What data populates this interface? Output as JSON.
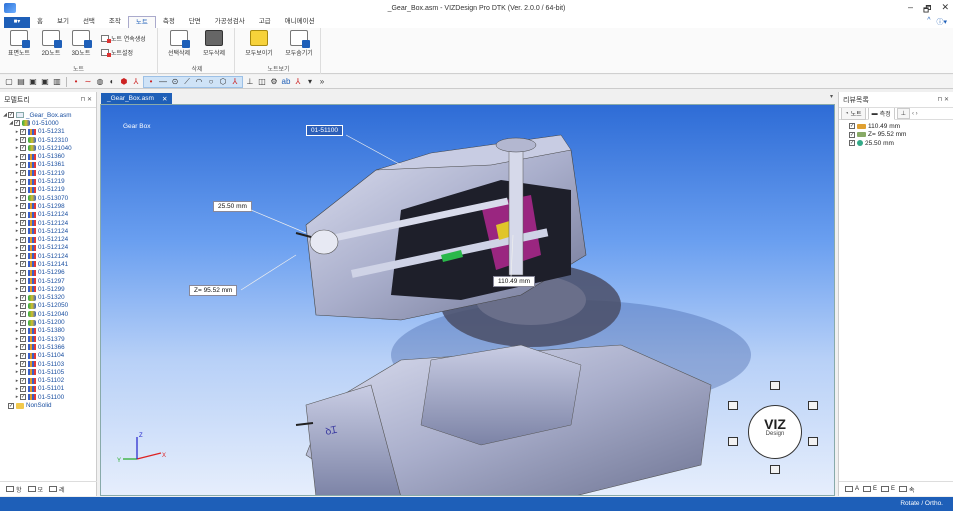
{
  "window": {
    "title": "_Gear_Box.asm - VIZDesign Pro DTK (Ver. 2.0.0 / 64-bit)",
    "min": "–",
    "max": "🗗",
    "close": "✕"
  },
  "ribbon_tabs": {
    "file": "■▾",
    "tabs": [
      "홈",
      "보기",
      "선택",
      "조작",
      "노트",
      "측정",
      "단면",
      "가공성검사",
      "고급",
      "애니메이션"
    ],
    "active_index": 4,
    "help": "^",
    "info": "ⓘ▾"
  },
  "ribbon": {
    "group_note": {
      "label": "노트",
      "surface_note": "표면노트",
      "note_2d": "2D노트",
      "note_3d": "3D노트",
      "continuous": "노트 연속생성",
      "settings": "노트설정"
    },
    "group_delete": {
      "label": "삭제",
      "delete_selected": "선택삭제",
      "delete_all": "모두삭제"
    },
    "group_view": {
      "label": "노트보기",
      "show_all": "모두보이기",
      "hide_all": "모두숨기기"
    }
  },
  "toolbar": {
    "icons": [
      "new-icon",
      "open-icon",
      "save-icon",
      "save-as-icon",
      "print-icon"
    ]
  },
  "left_panel": {
    "title": "모델트리",
    "pin": "⊓",
    "close": "✕",
    "root": "_Gear_Box.asm",
    "sub": "01-51000",
    "items": [
      "01-51231",
      "01-512310",
      "01-5121040",
      "01-51360",
      "01-51361",
      "01-51219",
      "01-51219",
      "01-51219",
      "01-513070",
      "01-51298",
      "01-512124",
      "01-512124",
      "01-512124",
      "01-512124",
      "01-512124",
      "01-512124",
      "01-512141",
      "01-51296",
      "01-51297",
      "01-51299",
      "01-51320",
      "01-512050",
      "01-512040",
      "01-51200",
      "01-51380",
      "01-51379",
      "01-51366",
      "01-51104",
      "01-51103",
      "01-51105",
      "01-51102",
      "01-51101",
      "01-51100"
    ],
    "nonsolid": "NonSolid",
    "footer": [
      "항",
      "모",
      "레"
    ]
  },
  "doc_tab": {
    "label": "_Gear_Box.asm",
    "close": "✕",
    "dropdown": "▾"
  },
  "viewport": {
    "model_label": "Gear Box",
    "measurements": {
      "top": "01-51100",
      "left_upper": "25.50 mm",
      "left_lower": "Z= 95.52 mm",
      "right": "110.49 mm"
    },
    "cube_logo": {
      "v1": "VIZ",
      "v2": "Design"
    },
    "axes": {
      "x": "X",
      "y": "Y",
      "z": "Z"
    }
  },
  "right_panel": {
    "title": "리뷰목록",
    "pin": "⊓",
    "close": "✕",
    "tabs": [
      "노트",
      "측정",
      "⊥"
    ],
    "active_tab": 1,
    "nav": "‹ ›",
    "rows": [
      "110.49 mm",
      "Z= 95.52 mm",
      "25.50 mm"
    ],
    "footer": [
      "A",
      "E",
      "E",
      "속"
    ]
  },
  "status": {
    "mode": "Rotate / Ortho."
  },
  "colors": {
    "accent": "#1e5fb8",
    "viewport_top": "#2e6cd6",
    "viewport_bottom": "#e6eefc"
  }
}
